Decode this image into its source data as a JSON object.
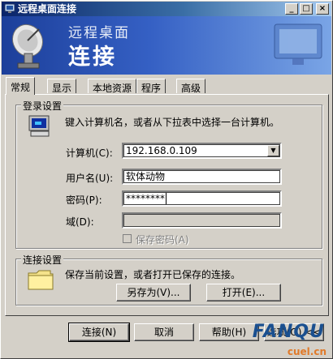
{
  "window": {
    "title": "远程桌面连接",
    "buttons": {
      "minimize": "_",
      "maximize": "□",
      "close": "×"
    }
  },
  "banner": {
    "line1": "远程桌面",
    "line2": "连接"
  },
  "tabs": [
    {
      "label": "常规",
      "active": true
    },
    {
      "label": "显示",
      "active": false
    },
    {
      "label": "本地资源",
      "active": false
    },
    {
      "label": "程序",
      "active": false
    },
    {
      "label": "高级",
      "active": false
    }
  ],
  "login": {
    "legend": "登录设置",
    "hint": "键入计算机名，或者从下拉表中选择一台计算机。",
    "computer_label": "计算机(C):",
    "computer_value": "192.168.0.109",
    "username_label": "用户名(U):",
    "username_value": "软体动物",
    "password_label": "密码(P):",
    "password_value": "********",
    "domain_label": "域(D):",
    "domain_value": "",
    "save_password_label": "保存密码(A)"
  },
  "connection": {
    "legend": "连接设置",
    "hint": "保存当前设置，或者打开已保存的连接。",
    "save_as": "另存为(V)...",
    "open": "打开(E)..."
  },
  "footer": {
    "connect": "连接(N)",
    "cancel": "取消",
    "help": "帮助(H)",
    "options": "选项(O) <<"
  },
  "watermark": {
    "brand": "FANQU",
    "site": "cuel.cn"
  },
  "colors": {
    "title_start": "#0a246a",
    "title_end": "#a6caf0",
    "face": "#d4d0c8"
  }
}
